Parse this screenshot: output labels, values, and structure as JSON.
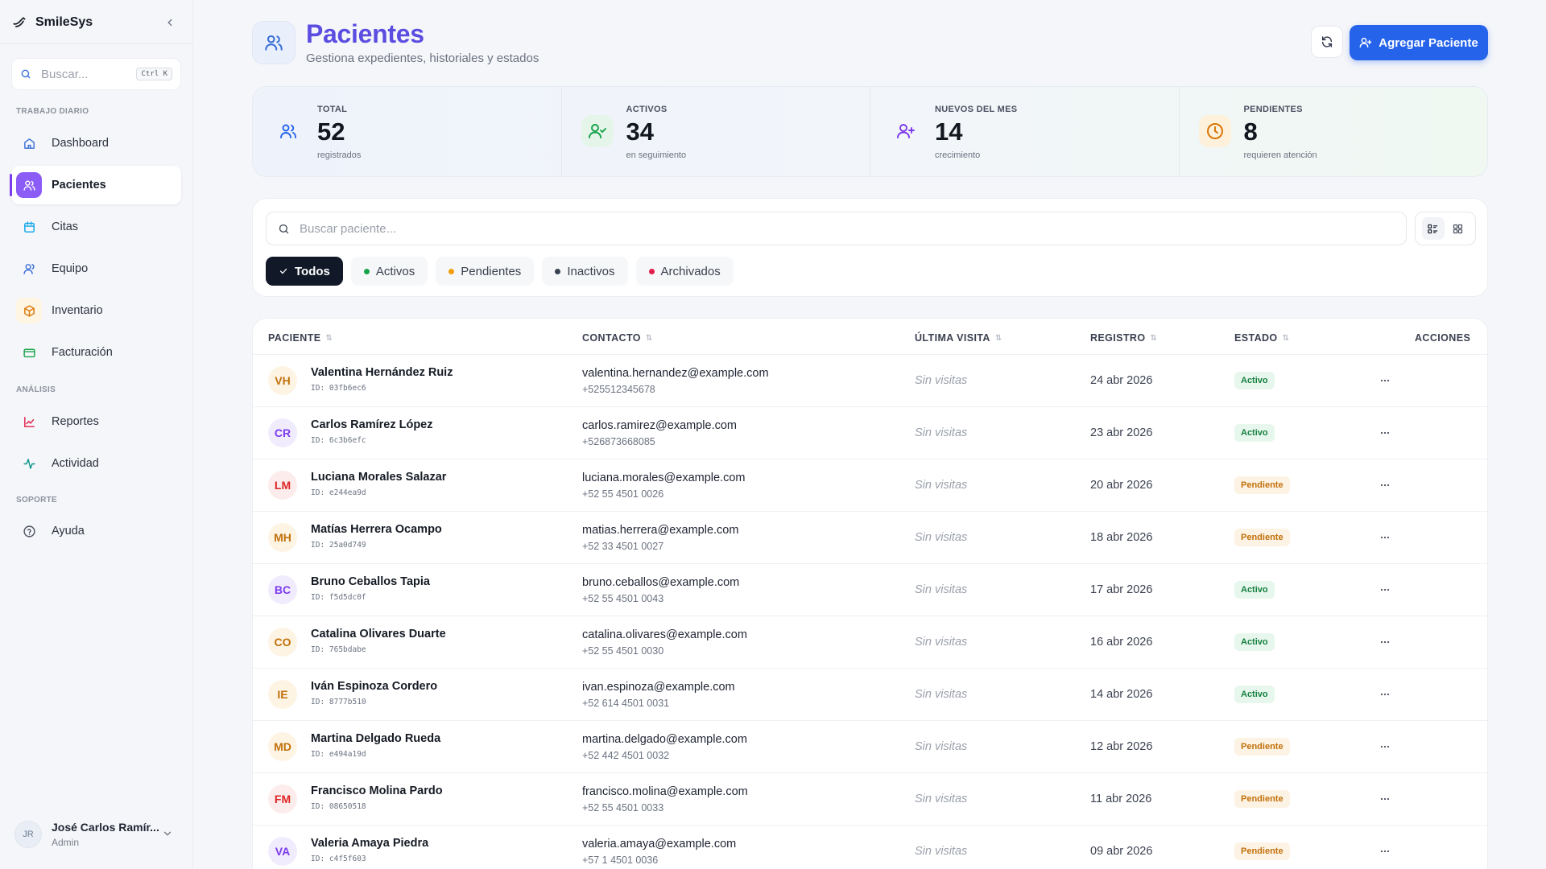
{
  "app": {
    "name": "SmileSys"
  },
  "sidebar": {
    "search_placeholder": "Buscar...",
    "shortcut": "Ctrl K",
    "sections": {
      "daily": "TRABAJO DIARIO",
      "analysis": "ANÁLISIS",
      "support": "SOPORTE"
    },
    "items": [
      {
        "label": "Dashboard",
        "icon": "home-icon"
      },
      {
        "label": "Pacientes",
        "icon": "users-icon",
        "active": true
      },
      {
        "label": "Citas",
        "icon": "calendar-icon"
      },
      {
        "label": "Equipo",
        "icon": "user-icon"
      },
      {
        "label": "Inventario",
        "icon": "box-icon"
      },
      {
        "label": "Facturación",
        "icon": "card-icon"
      },
      {
        "label": "Reportes",
        "icon": "chart-icon"
      },
      {
        "label": "Actividad",
        "icon": "activity-icon"
      },
      {
        "label": "Ayuda",
        "icon": "help-icon"
      }
    ],
    "user": {
      "initials": "JR",
      "name": "José Carlos Ramír...",
      "role": "Admin"
    }
  },
  "header": {
    "title": "Pacientes",
    "subtitle": "Gestiona expedientes, historiales y estados",
    "add_label": "Agregar Paciente"
  },
  "stats": [
    {
      "label": "TOTAL",
      "value": "52",
      "caption": "registrados",
      "color": "#2563eb"
    },
    {
      "label": "ACTIVOS",
      "value": "34",
      "caption": "en seguimiento",
      "color": "#16a34a"
    },
    {
      "label": "NUEVOS DEL MES",
      "value": "14",
      "caption": "crecimiento",
      "color": "#7c3aed"
    },
    {
      "label": "PENDIENTES",
      "value": "8",
      "caption": "requieren atención",
      "color": "#d97706"
    }
  ],
  "filters": {
    "search_placeholder": "Buscar paciente...",
    "chips": [
      {
        "label": "Todos",
        "active": true
      },
      {
        "label": "Activos",
        "color": "#16a34a"
      },
      {
        "label": "Pendientes",
        "color": "#f59e0b"
      },
      {
        "label": "Inactivos",
        "color": "#374151"
      },
      {
        "label": "Archivados",
        "color": "#e11d48"
      }
    ]
  },
  "table": {
    "headers": {
      "patient": "PACIENTE",
      "contact": "CONTACTO",
      "last_visit": "ÚLTIMA VISITA",
      "registered": "REGISTRO",
      "status": "ESTADO",
      "actions": "ACCIONES"
    },
    "rows": [
      {
        "initials": "VH",
        "name": "Valentina Hernández Ruiz",
        "id": "ID: 03fb6ec6",
        "email": "valentina.hernandez@example.com",
        "phone": "+525512345678",
        "visit": "Sin visitas",
        "date": "24 abr 2026",
        "status": "Activo",
        "bg": "#fdf4e3",
        "fg": "#c2700b"
      },
      {
        "initials": "CR",
        "name": "Carlos Ramírez López",
        "id": "ID: 6c3b6efc",
        "email": "carlos.ramirez@example.com",
        "phone": "+526873668085",
        "visit": "Sin visitas",
        "date": "23 abr 2026",
        "status": "Activo",
        "bg": "#f1ecfd",
        "fg": "#7c3aed"
      },
      {
        "initials": "LM",
        "name": "Luciana Morales Salazar",
        "id": "ID: e244ea9d",
        "email": "luciana.morales@example.com",
        "phone": "+52 55 4501 0026",
        "visit": "Sin visitas",
        "date": "20 abr 2026",
        "status": "Pendiente",
        "bg": "#fdecec",
        "fg": "#dc2626"
      },
      {
        "initials": "MH",
        "name": "Matías Herrera Ocampo",
        "id": "ID: 25a0d749",
        "email": "matias.herrera@example.com",
        "phone": "+52 33 4501 0027",
        "visit": "Sin visitas",
        "date": "18 abr 2026",
        "status": "Pendiente",
        "bg": "#fdf4e3",
        "fg": "#c2700b"
      },
      {
        "initials": "BC",
        "name": "Bruno Ceballos Tapia",
        "id": "ID: f5d5dc0f",
        "email": "bruno.ceballos@example.com",
        "phone": "+52 55 4501 0043",
        "visit": "Sin visitas",
        "date": "17 abr 2026",
        "status": "Activo",
        "bg": "#f1ecfd",
        "fg": "#7c3aed"
      },
      {
        "initials": "CO",
        "name": "Catalina Olivares Duarte",
        "id": "ID: 765bdabe",
        "email": "catalina.olivares@example.com",
        "phone": "+52 55 4501 0030",
        "visit": "Sin visitas",
        "date": "16 abr 2026",
        "status": "Activo",
        "bg": "#fdf4e3",
        "fg": "#c2700b"
      },
      {
        "initials": "IE",
        "name": "Iván Espinoza Cordero",
        "id": "ID: 8777b510",
        "email": "ivan.espinoza@example.com",
        "phone": "+52 614 4501 0031",
        "visit": "Sin visitas",
        "date": "14 abr 2026",
        "status": "Activo",
        "bg": "#fdf4e3",
        "fg": "#c2700b"
      },
      {
        "initials": "MD",
        "name": "Martina Delgado Rueda",
        "id": "ID: e494a19d",
        "email": "martina.delgado@example.com",
        "phone": "+52 442 4501 0032",
        "visit": "Sin visitas",
        "date": "12 abr 2026",
        "status": "Pendiente",
        "bg": "#fdf4e3",
        "fg": "#c2700b"
      },
      {
        "initials": "FM",
        "name": "Francisco Molina Pardo",
        "id": "ID: 08650518",
        "email": "francisco.molina@example.com",
        "phone": "+52 55 4501 0033",
        "visit": "Sin visitas",
        "date": "11 abr 2026",
        "status": "Pendiente",
        "bg": "#fdecec",
        "fg": "#dc2626"
      },
      {
        "initials": "VA",
        "name": "Valeria Amaya Piedra",
        "id": "ID: c4f5f603",
        "email": "valeria.amaya@example.com",
        "phone": "+57 1 4501 0036",
        "visit": "Sin visitas",
        "date": "09 abr 2026",
        "status": "Pendiente",
        "bg": "#f1ecfd",
        "fg": "#7c3aed"
      }
    ]
  }
}
